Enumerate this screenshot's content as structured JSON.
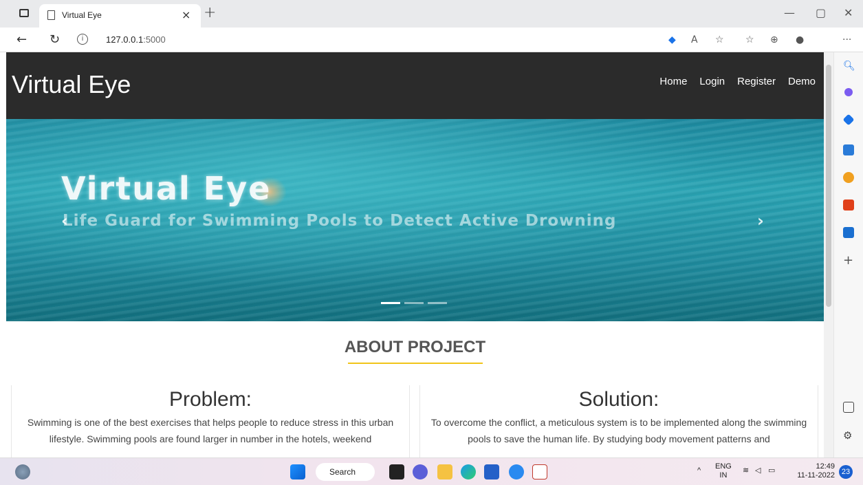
{
  "browser": {
    "tab_title": "Virtual Eye",
    "url_host": "127.0.0.1",
    "url_port": ":5000"
  },
  "site": {
    "brand": "Virtual Eye",
    "nav": [
      "Home",
      "Login",
      "Register",
      "Demo"
    ]
  },
  "hero": {
    "title": "Virtual Eye",
    "subtitle": "Life Guard for Swimming Pools to Detect Active Drowning",
    "active_slide": 1,
    "slide_count": 3
  },
  "about": {
    "heading": "ABOUT PROJECT",
    "problem_title": "Problem:",
    "problem_text": "Swimming is one of the best exercises that helps people to reduce stress in this urban lifestyle. Swimming pools are found larger in number in the hotels, weekend",
    "solution_title": "Solution:",
    "solution_text": "To overcome the conflict, a meticulous system is to be implemented along the swimming pools to save the human life. By studying body movement patterns and"
  },
  "taskbar": {
    "search_label": "Search",
    "lang": "ENG",
    "region": "IN",
    "time": "12:49",
    "date": "11-11-2022",
    "notifications": "23"
  },
  "colors": {
    "header_bg": "#2b2b2b",
    "accent_underline": "#f0c419"
  }
}
